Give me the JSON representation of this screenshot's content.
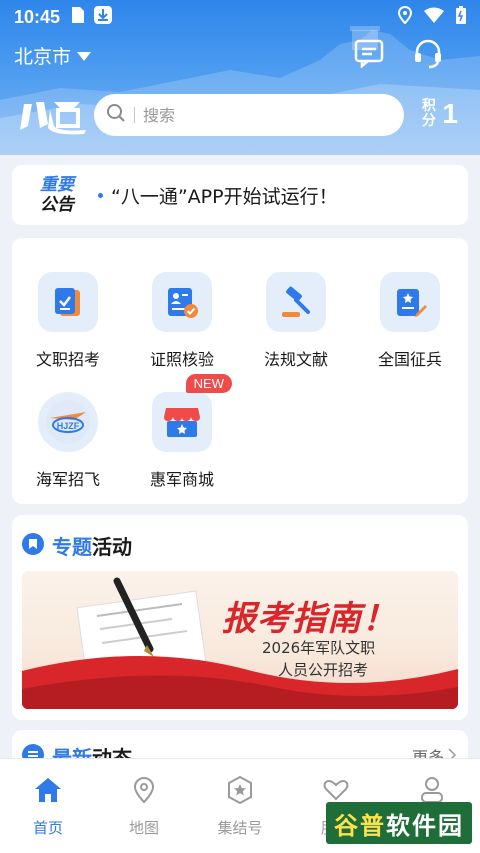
{
  "status_bar": {
    "time": "10:45",
    "icons": [
      "sim-card-icon",
      "download-icon",
      "location-icon",
      "wifi-icon",
      "battery-icon"
    ]
  },
  "header": {
    "city": "北京市",
    "logo_text": "八通",
    "search_placeholder": "搜索",
    "points_label": "积分",
    "points_value": "1",
    "icons": [
      "message-icon",
      "customer-service-icon"
    ]
  },
  "notice": {
    "badge_line1": "重要",
    "badge_line2": "公告",
    "text": "“八一通”APP开始试运行！"
  },
  "services": [
    {
      "label": "文职招考",
      "icon": "checklist-icon"
    },
    {
      "label": "证照核验",
      "icon": "id-card-verify-icon"
    },
    {
      "label": "法规文献",
      "icon": "gavel-icon"
    },
    {
      "label": "全国征兵",
      "icon": "enlistment-form-icon"
    },
    {
      "label": "海军招飞",
      "icon": "navy-pilot-icon"
    },
    {
      "label": "惠军商城",
      "icon": "store-icon",
      "badge": "NEW"
    }
  ],
  "topic": {
    "title_part1": "专题",
    "title_part2": "活动",
    "banner_title": "报考指南！",
    "banner_line1": "2026年军队文职",
    "banner_line2": "人员公开招考"
  },
  "news": {
    "title_part1": "最新",
    "title_part2": "动态",
    "more": "更多"
  },
  "bottom_nav": [
    {
      "label": "首页",
      "icon": "home-icon",
      "active": true
    },
    {
      "label": "地图",
      "icon": "map-pin-icon",
      "active": false
    },
    {
      "label": "集结号",
      "icon": "badge-star-icon",
      "active": false
    },
    {
      "label": "服务",
      "icon": "heart-hands-icon",
      "active": false
    },
    {
      "label": "我的",
      "icon": "user-icon",
      "active": false
    }
  ],
  "watermark": {
    "part1": "谷普",
    "part2": "软件园"
  },
  "colors": {
    "accent": "#2e7ae8",
    "header": "#2f86ea",
    "badge_red": "#f04b4b",
    "banner_red": "#d8262b"
  }
}
